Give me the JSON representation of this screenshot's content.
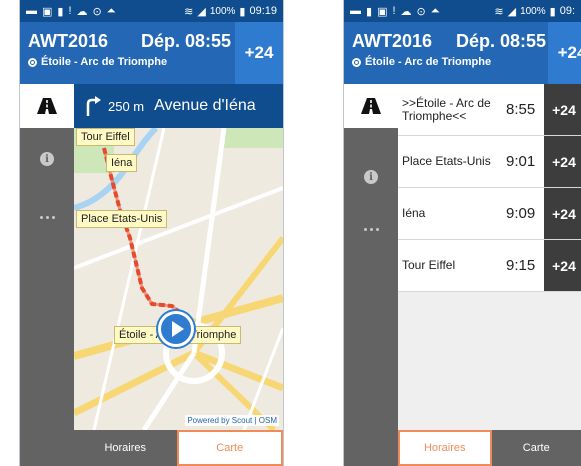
{
  "status_bar": {
    "battery": "100%",
    "time_a": "09:19",
    "time_b": "09:",
    "icons": [
      "notification-icon",
      "image-icon",
      "phone-icon",
      "alert-icon",
      "cloud-icon",
      "sync-icon",
      "wifi-icon",
      "signal-icon",
      "battery-icon"
    ]
  },
  "header": {
    "route": "AWT2016",
    "departure": "Dép. 08:55",
    "stop": "Étoile - Arc de Triomphe",
    "delay": "+24"
  },
  "navigation": {
    "distance": "250 m",
    "street": "Avenue d'Iéna"
  },
  "map": {
    "labels": [
      "Tour Eiffel",
      "Iéna",
      "Place Etats-Unis",
      "Étoile - Arc de Triomphe"
    ],
    "credit": "Powered by Scout | OSM"
  },
  "bottom_tabs": {
    "schedules": "Horaires",
    "map": "Carte"
  },
  "stops": [
    {
      "name": ">>Étoile - Arc de Triomphe<<",
      "time": "8:55",
      "delay": "+24"
    },
    {
      "name": "Place Etats-Unis",
      "time": "9:01",
      "delay": "+24"
    },
    {
      "name": "Iéna",
      "time": "9:09",
      "delay": "+24"
    },
    {
      "name": "Tour Eiffel",
      "time": "9:15",
      "delay": "+24"
    }
  ],
  "colors": {
    "header": "#2468b5",
    "status_bar": "#0f4d8f",
    "sidebar": "#636363",
    "active_tab": "#f08c5a",
    "route_line": "#e64a2e"
  }
}
